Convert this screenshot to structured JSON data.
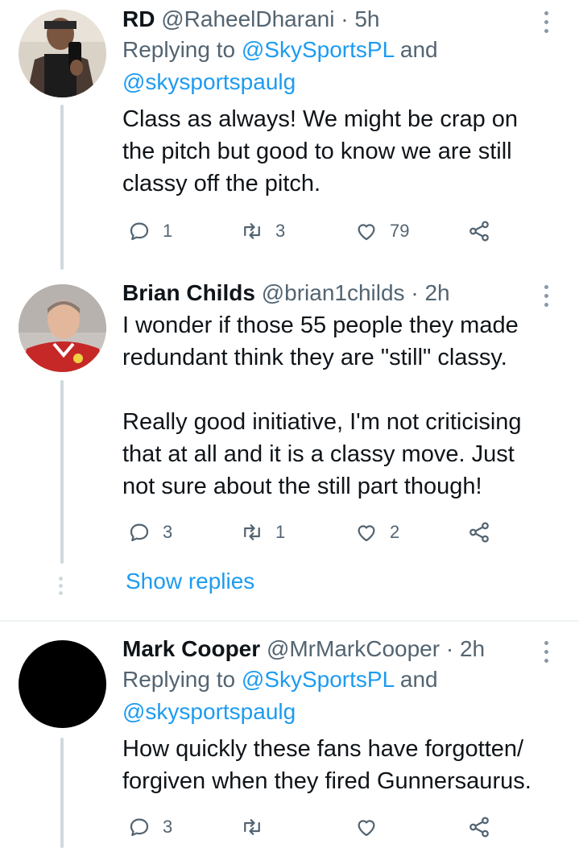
{
  "tweets": [
    {
      "name": "RD",
      "handle": "@RaheelDharani",
      "dot": " · ",
      "time": "5h",
      "replying_prefix": "Replying to ",
      "mention1": "@SkySportsPL",
      "and": " and",
      "mention2": "@skysportspaulg",
      "text": "Class as always! We might be crap on\nthe pitch but good to know we are still\nclassy off the pitch.",
      "replies": "1",
      "retweets": "3",
      "likes": "79"
    },
    {
      "name": "Brian Childs",
      "handle": "@brian1childs",
      "dot": " · ",
      "time": "2h",
      "text": "I wonder if those 55 people they made\nredundant think they are \"still\" classy.\n\nReally good initiative, I'm not criticising\nthat at all and it is a classy move. Just\nnot sure about the still part though!",
      "replies": "3",
      "retweets": "1",
      "likes": "2"
    },
    {
      "name": "Mark Cooper",
      "handle": "@MrMarkCooper",
      "dot": " · ",
      "time": "2h",
      "replying_prefix": "Replying to ",
      "mention1": "@SkySportsPL",
      "and": " and",
      "mention2": "@skysportspaulg",
      "text": "How quickly these fans have forgotten/\nforgiven when they fired Gunnersaurus.",
      "replies": "3",
      "retweets": "",
      "likes": ""
    }
  ],
  "show_replies": "Show replies",
  "colors": {
    "link": "#1d9bf0",
    "secondary": "#536471",
    "line": "#cfd9de"
  }
}
